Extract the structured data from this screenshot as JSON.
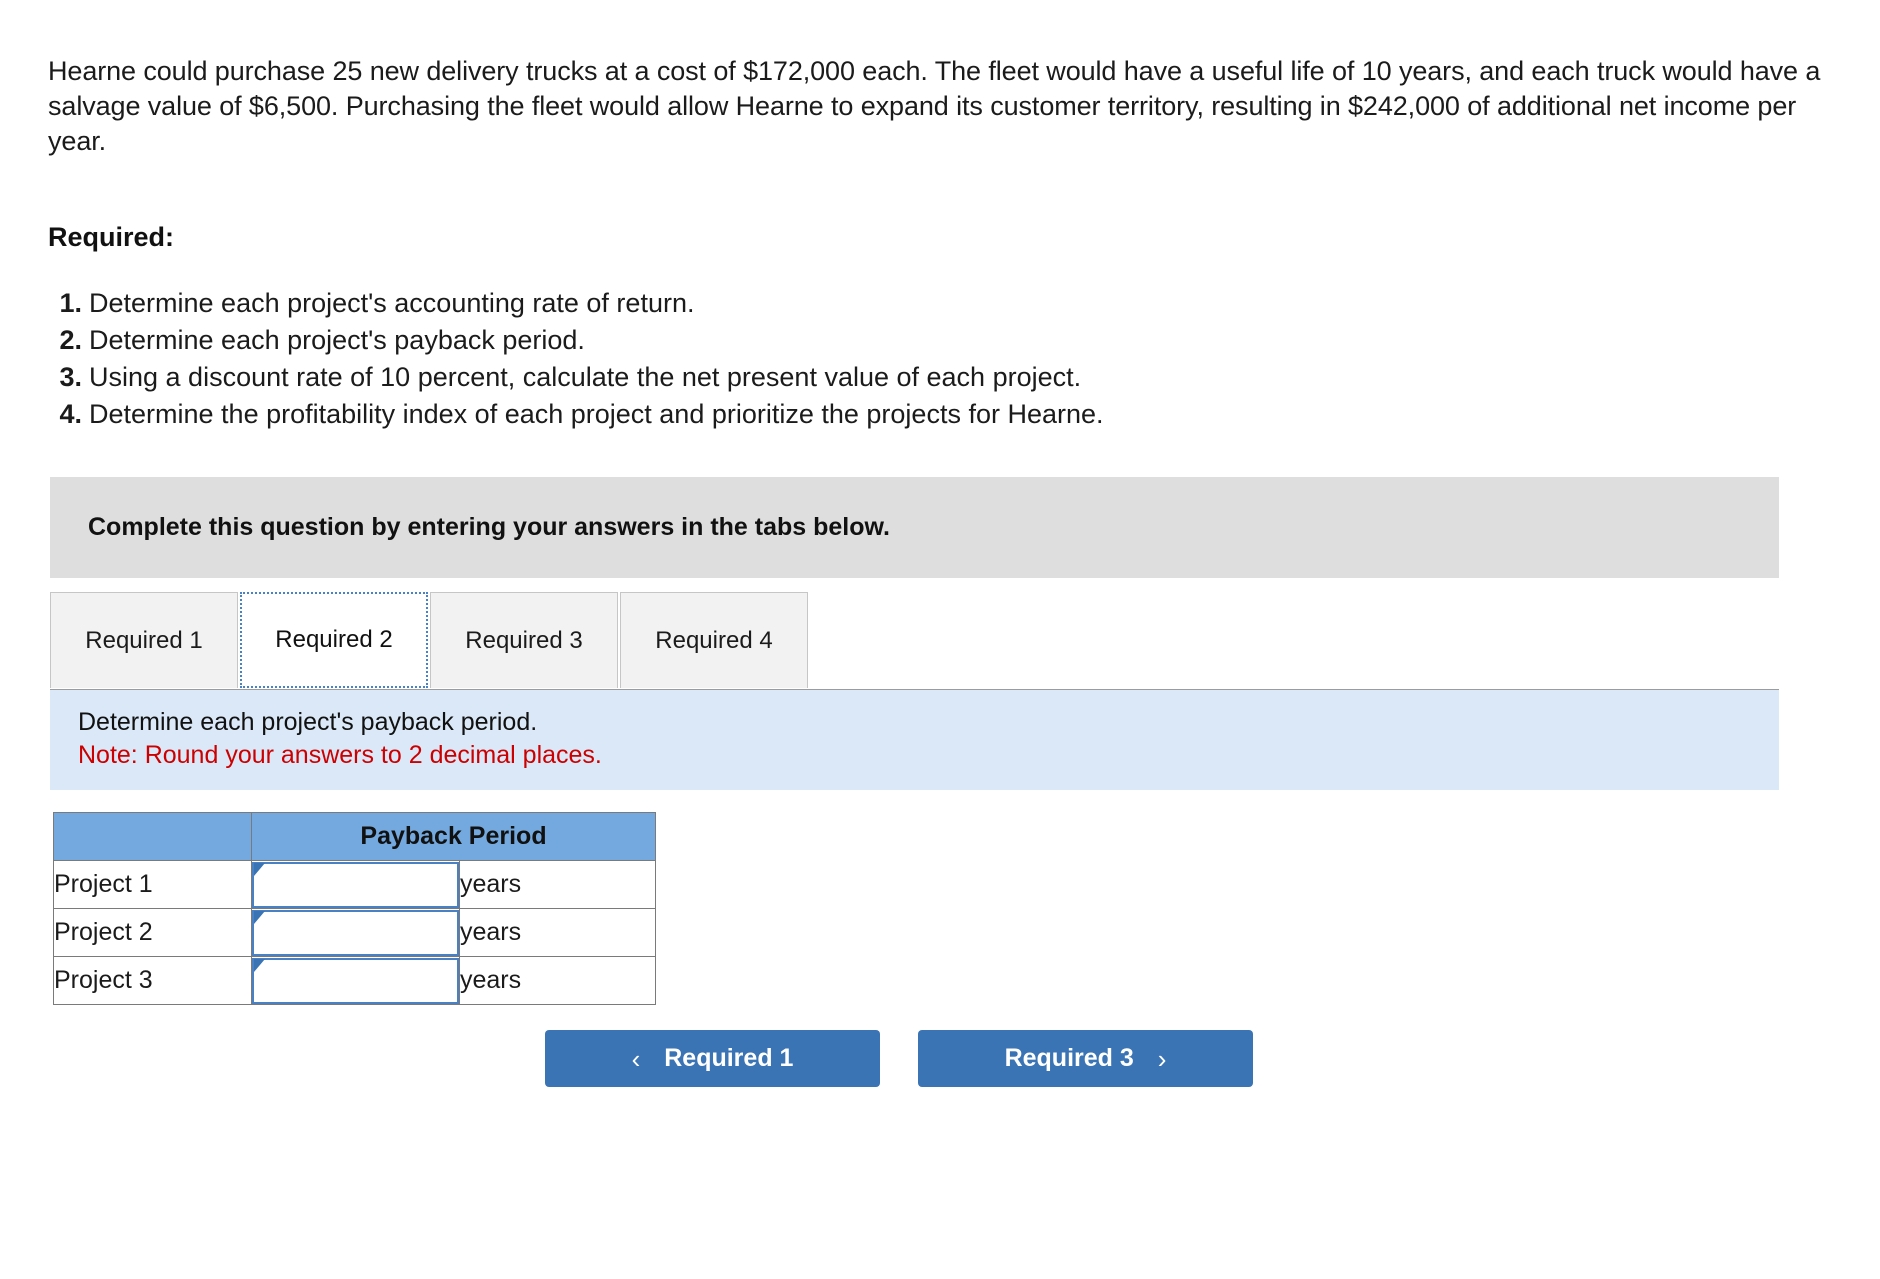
{
  "problem": {
    "paragraph": "Hearne could purchase 25 new delivery trucks at a cost of $172,000 each. The fleet would have a useful life of 10 years, and each truck would have a salvage value of $6,500. Purchasing the fleet would allow Hearne to expand its customer territory, resulting in $242,000 of additional net income per year.",
    "required_heading": "Required:",
    "requirements": [
      {
        "num": "1.",
        "text": "Determine each project's accounting rate of return."
      },
      {
        "num": "2.",
        "text": "Determine each project's payback period."
      },
      {
        "num": "3.",
        "text": "Using a discount rate of 10 percent, calculate the net present value of each project."
      },
      {
        "num": "4.",
        "text": "Determine the profitability index of each project and prioritize the projects for Hearne."
      }
    ]
  },
  "banner": {
    "text": "Complete this question by entering your answers in the tabs below."
  },
  "tabs": [
    {
      "label": "Required 1",
      "active": false
    },
    {
      "label": "Required 2",
      "active": true
    },
    {
      "label": "Required 3",
      "active": false
    },
    {
      "label": "Required 4",
      "active": false
    }
  ],
  "instruction": {
    "line1": "Determine each project's payback period.",
    "note": "Note: Round your answers to 2 decimal places."
  },
  "answer_table": {
    "headers": [
      "",
      "Payback Period"
    ],
    "rows": [
      {
        "label": "Project 1",
        "value": "",
        "unit": "years"
      },
      {
        "label": "Project 2",
        "value": "",
        "unit": "years"
      },
      {
        "label": "Project 3",
        "value": "",
        "unit": "years"
      }
    ]
  },
  "navigation": {
    "prev_label": "Required 1",
    "prev_icon": "chevron-left-icon",
    "prev_glyph": "‹",
    "next_label": "Required 3",
    "next_icon": "chevron-right-icon",
    "next_glyph": "›"
  },
  "colors": {
    "banner_gray": "#dedede",
    "panel_blue": "#dae8f7",
    "table_header_blue": "#74a9e0",
    "button_blue": "#3a74b4",
    "note_red": "#cc0000",
    "input_border_blue": "#4a80c4"
  }
}
